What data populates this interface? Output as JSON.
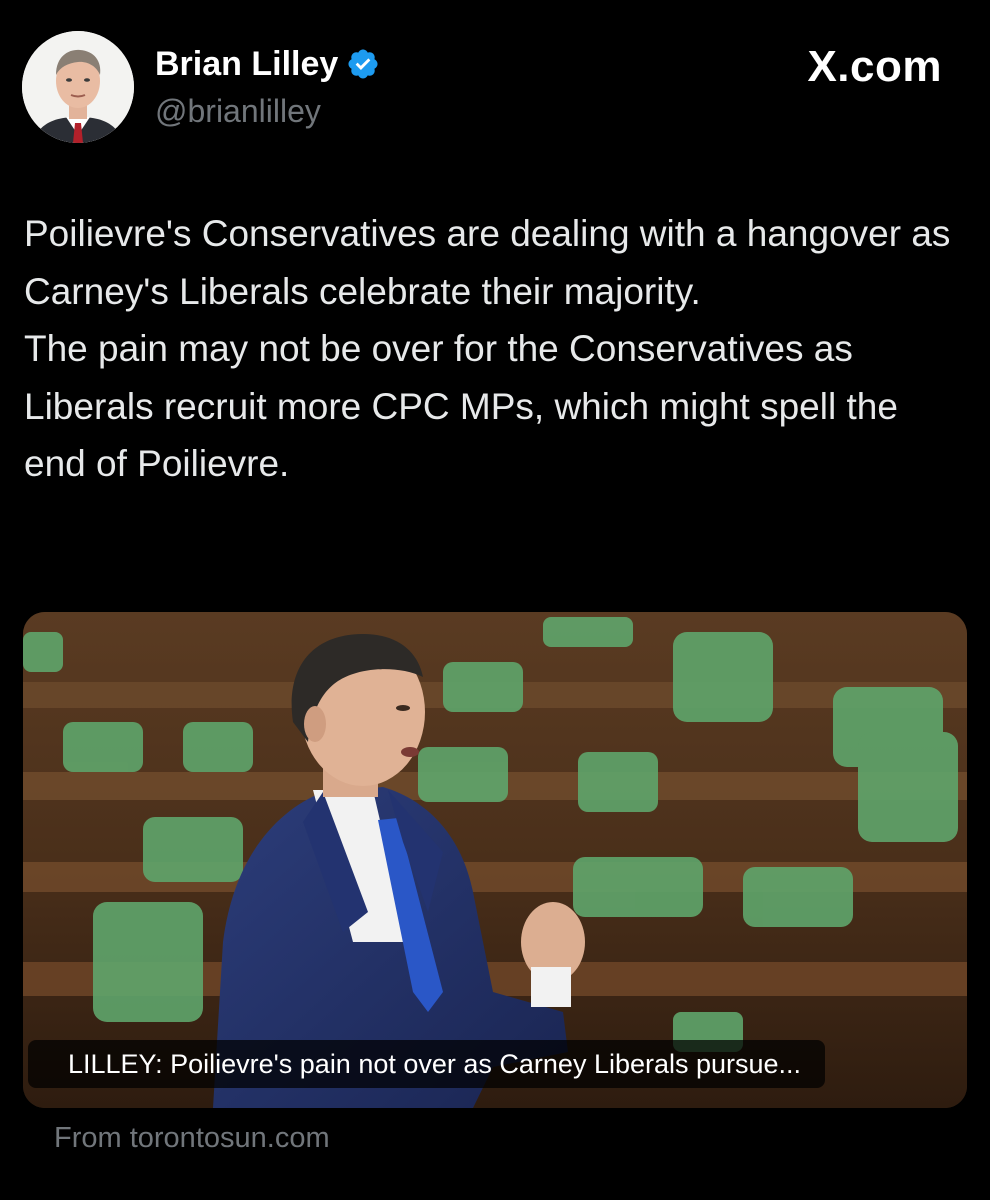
{
  "author": {
    "display_name": "Brian Lilley",
    "handle": "@brianlilley",
    "verified": true,
    "avatar_icon": "profile-photo"
  },
  "site": {
    "label": "X.com"
  },
  "tweet": {
    "paragraphs": [
      "Poilievre's Conservatives are dealing with a hangover as Carney's Liberals celebrate their majority.",
      "The pain may not be over for the Conservatives as Liberals recruit more CPC MPs, which might spell the end of Poilievre."
    ]
  },
  "card": {
    "headline": "LILLEY: Poilievre's pain not over as Carney Liberals pursue...",
    "source": "From torontosun.com"
  },
  "colors": {
    "background": "#000000",
    "text_primary": "#e7e9ea",
    "text_secondary": "#71767b",
    "verified_blue": "#1d9bf0"
  }
}
